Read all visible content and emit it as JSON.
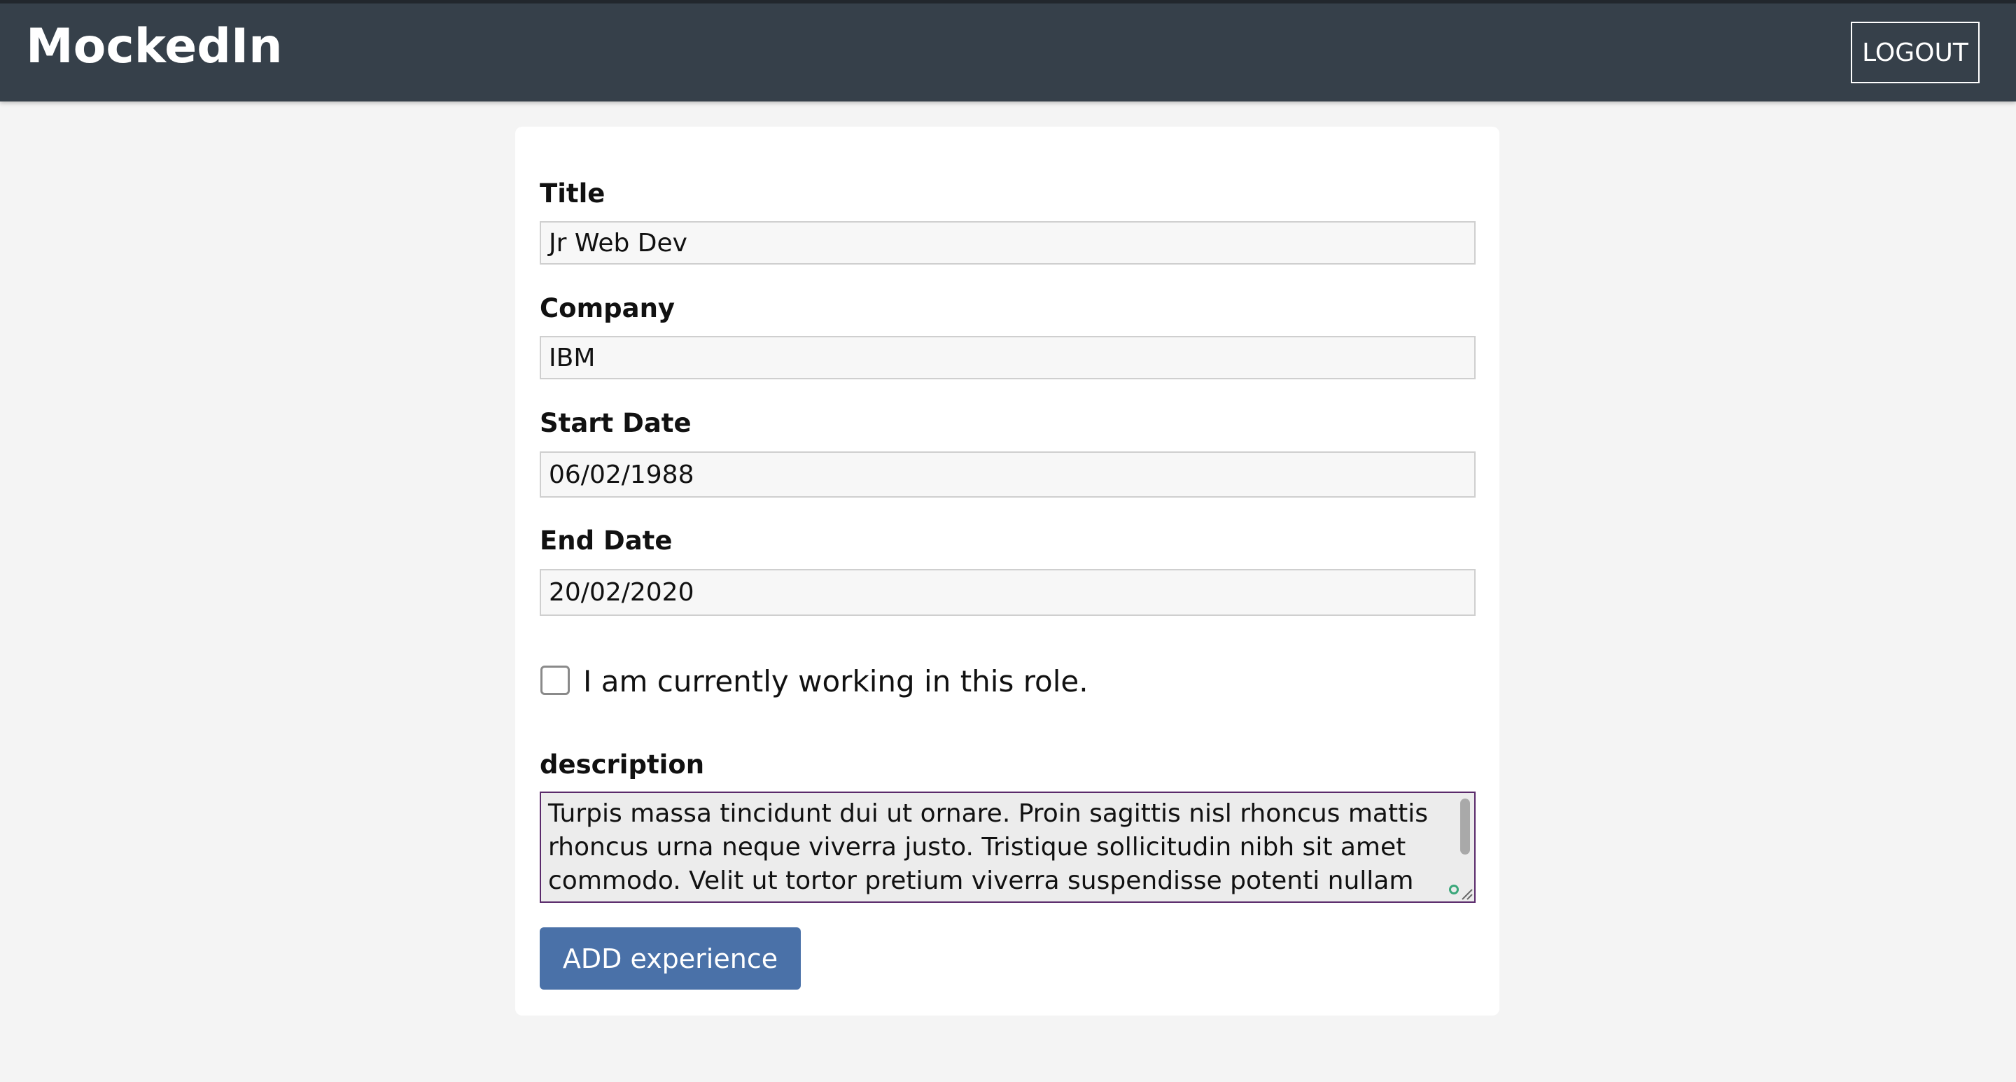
{
  "header": {
    "brand": "MockedIn",
    "logout_label": "LOGOUT"
  },
  "form": {
    "title": {
      "label": "Title",
      "value": "Jr Web Dev"
    },
    "company": {
      "label": "Company",
      "value": "IBM"
    },
    "start_date": {
      "label": "Start Date",
      "value": "06/02/1988"
    },
    "end_date": {
      "label": "End Date",
      "value": "20/02/2020"
    },
    "current_role": {
      "label": "I am currently working in this role.",
      "checked": false
    },
    "description": {
      "label": "description",
      "value": "Turpis massa tincidunt dui ut ornare. Proin sagittis nisl rhoncus mattis rhoncus urna neque viverra justo. Tristique sollicitudin nibh sit amet commodo. Velit ut tortor pretium viverra suspendisse potenti nullam ac. Ac ut"
    },
    "submit_label": "ADD experience"
  },
  "colors": {
    "header_bg": "#36404a",
    "button_bg": "#4a71a8",
    "page_bg": "#f4f4f4"
  },
  "icons": {
    "checkbox": "checkbox-unchecked",
    "resize": "resize-grip-icon",
    "grammar": "grammar-check-icon"
  }
}
